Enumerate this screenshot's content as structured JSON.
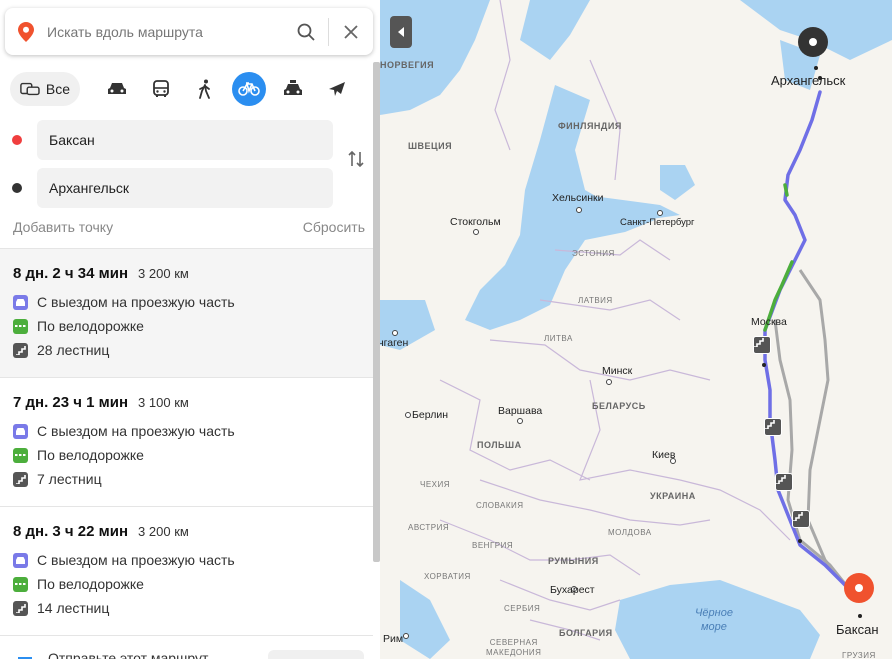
{
  "search": {
    "placeholder": "Искать вдоль маршрута"
  },
  "modes": [
    {
      "name": "all",
      "label": "Все"
    },
    {
      "name": "car",
      "icon": "car-icon"
    },
    {
      "name": "transit",
      "icon": "bus-icon"
    },
    {
      "name": "walk",
      "icon": "walking-icon"
    },
    {
      "name": "bike",
      "icon": "bicycle-icon",
      "active": true
    },
    {
      "name": "taxi",
      "icon": "taxi-icon"
    },
    {
      "name": "plane",
      "icon": "airplane-icon"
    }
  ],
  "points": {
    "from": "Баксан",
    "to": "Архангельск"
  },
  "links": {
    "add_point": "Добавить точку",
    "reset": "Сбросить"
  },
  "routes": [
    {
      "duration": "8 дн. 2 ч 34 мин",
      "distance": "3 200 км",
      "road": "С выездом на проезжую часть",
      "bike": "По велодорожке",
      "stairs": "28 лестниц",
      "selected": true
    },
    {
      "duration": "7 дн. 23 ч 1 мин",
      "distance": "3 100 км",
      "road": "С выездом на проезжую часть",
      "bike": "По велодорожке",
      "stairs": "7 лестниц"
    },
    {
      "duration": "8 дн. 3 ч 22 мин",
      "distance": "3 200 км",
      "road": "С выездом на проезжую часть",
      "bike": "По велодорожке",
      "stairs": "14 лестниц"
    }
  ],
  "bottom": {
    "send_label": "Отправьте этот маршрут"
  },
  "map": {
    "start_label": "Баксан",
    "end_label": "Архангельск",
    "countries": [
      "НОРВЕГИЯ",
      "ФИНЛЯНДИЯ",
      "ШВЕЦИЯ",
      "ЭСТОНИЯ",
      "ЛАТВИЯ",
      "ЛИТВА",
      "BELARUS",
      "ПОЛЬША",
      "ЧЕХИЯ",
      "СЛОВАКИЯ",
      "УКРАИНА",
      "АВСТРИЯ",
      "ВЕНГРИЯ",
      "МОЛДОВА",
      "РУМЫНИЯ",
      "ХОРВАТИЯ",
      "СЕРБИЯ",
      "БОЛГАРИЯ",
      "СЕВЕРНАЯ МАКЕДОНИЯ",
      "ГРУЗИЯ"
    ],
    "cities": [
      "Хельсинки",
      "Стокгольм",
      "Санкт-Петербург",
      "Москва",
      "Минск",
      "Берлин",
      "Варшава",
      "Киев",
      "Бухарест",
      "Рим",
      "Копенгаген"
    ],
    "seas": [
      "Чёрное море"
    ],
    "colors": {
      "road": "#6f6fe6",
      "bike": "#4cae3c",
      "alt_route": "#a8a8a8",
      "start_pin": "#f0522e",
      "end_pin": "#333333"
    }
  }
}
